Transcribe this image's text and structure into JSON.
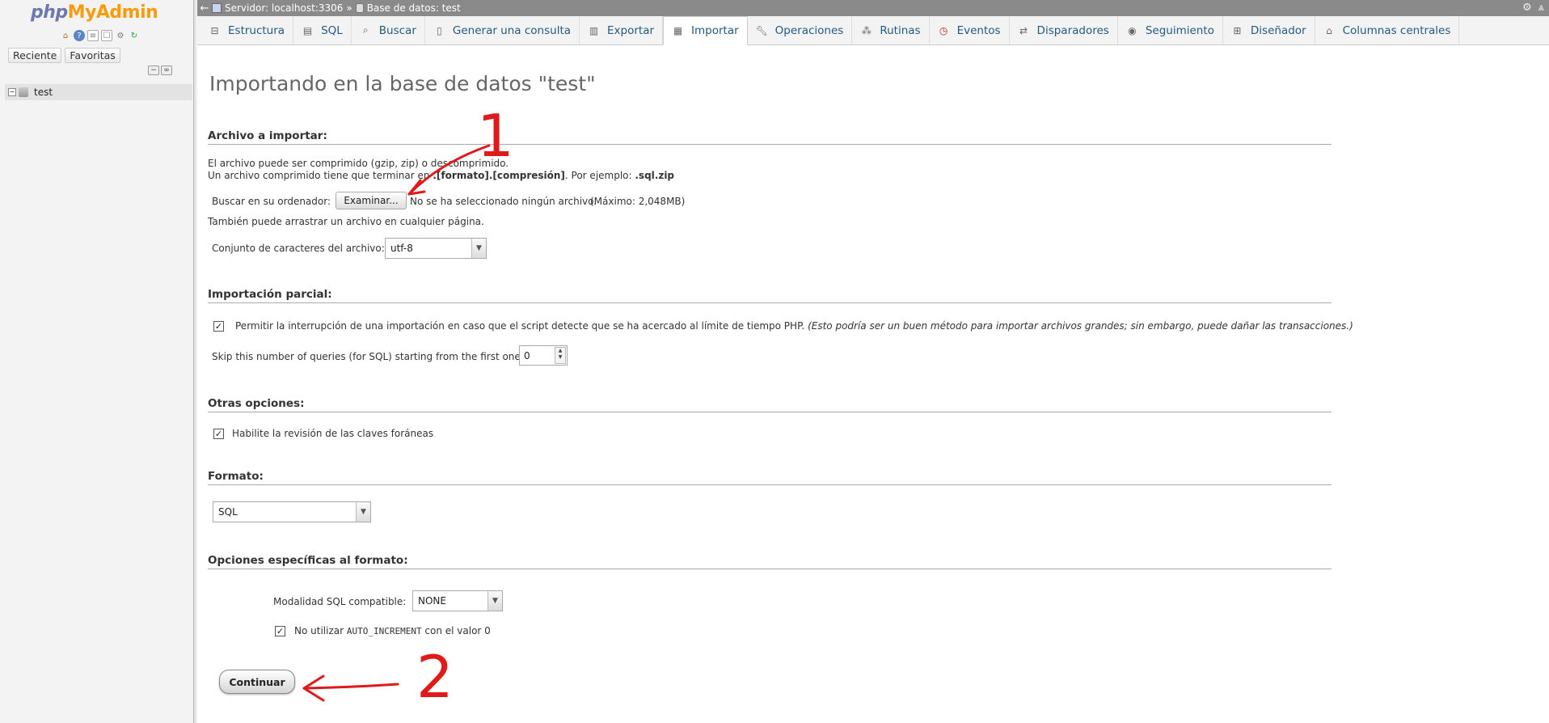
{
  "sidebar": {
    "logo_php": "php",
    "logo_myadmin": "MyAdmin",
    "tab_recent": "Reciente",
    "tab_favorites": "Favoritas",
    "db_item": "test"
  },
  "topbar": {
    "server": "Servidor: localhost:3306",
    "separator": "»",
    "database": "Base de datos: test"
  },
  "tabs": [
    {
      "label": "Estructura",
      "icon": "structure-icon"
    },
    {
      "label": "SQL",
      "icon": "sql-icon"
    },
    {
      "label": "Buscar",
      "icon": "search-icon"
    },
    {
      "label": "Generar una consulta",
      "icon": "query-icon"
    },
    {
      "label": "Exportar",
      "icon": "export-icon"
    },
    {
      "label": "Importar",
      "icon": "import-icon",
      "active": true
    },
    {
      "label": "Operaciones",
      "icon": "wrench-icon"
    },
    {
      "label": "Rutinas",
      "icon": "routines-icon"
    },
    {
      "label": "Eventos",
      "icon": "clock-icon"
    },
    {
      "label": "Disparadores",
      "icon": "triggers-icon"
    },
    {
      "label": "Seguimiento",
      "icon": "eye-icon"
    },
    {
      "label": "Diseñador",
      "icon": "designer-icon"
    },
    {
      "label": "Columnas centrales",
      "icon": "columns-icon"
    }
  ],
  "main": {
    "title": "Importando en la base de datos \"test\"",
    "file_section": {
      "heading": "Archivo a importar:",
      "line1": "El archivo puede ser comprimido (gzip, zip) o descomprimido.",
      "line2_a": "Un archivo comprimido tiene que terminar en ",
      "line2_b": ".[formato].[compresión]",
      "line2_c": ". Por ejemplo: ",
      "line2_d": ".sql.zip",
      "browse_label": "Buscar en su ordenador:",
      "browse_button": "Examinar...",
      "no_file": "No se ha seleccionado ningún archivo.",
      "max_size": "(Máximo: 2,048MB)",
      "drag_text": "También puede arrastrar un archivo en cualquier página.",
      "charset_label": "Conjunto de caracteres del archivo:",
      "charset_value": "utf-8"
    },
    "partial_section": {
      "heading": "Importación parcial:",
      "allow_interrupt": "Permitir la interrupción de una importación en caso que el script detecte que se ha acercado al límite de tiempo PHP.",
      "allow_interrupt_note": "(Esto podría ser un buen método para importar archivos grandes; sin embargo, puede dañar las transacciones.)",
      "skip_label": "Skip this number of queries (for SQL) starting from the first one:",
      "skip_value": "0"
    },
    "other_section": {
      "heading": "Otras opciones:",
      "fk_check": "Habilite la revisión de las claves foráneas"
    },
    "format_section": {
      "heading": "Formato:",
      "format_value": "SQL"
    },
    "format_options": {
      "heading": "Opciones específicas al formato:",
      "compat_label": "Modalidad SQL compatible:",
      "compat_value": "NONE",
      "no_auto_a": "No utilizar ",
      "no_auto_b": "AUTO_INCREMENT",
      "no_auto_c": " con el valor 0"
    },
    "submit": "Continuar"
  },
  "annotations": {
    "label1": "1",
    "label2": "2",
    "color": "#e0191a"
  }
}
